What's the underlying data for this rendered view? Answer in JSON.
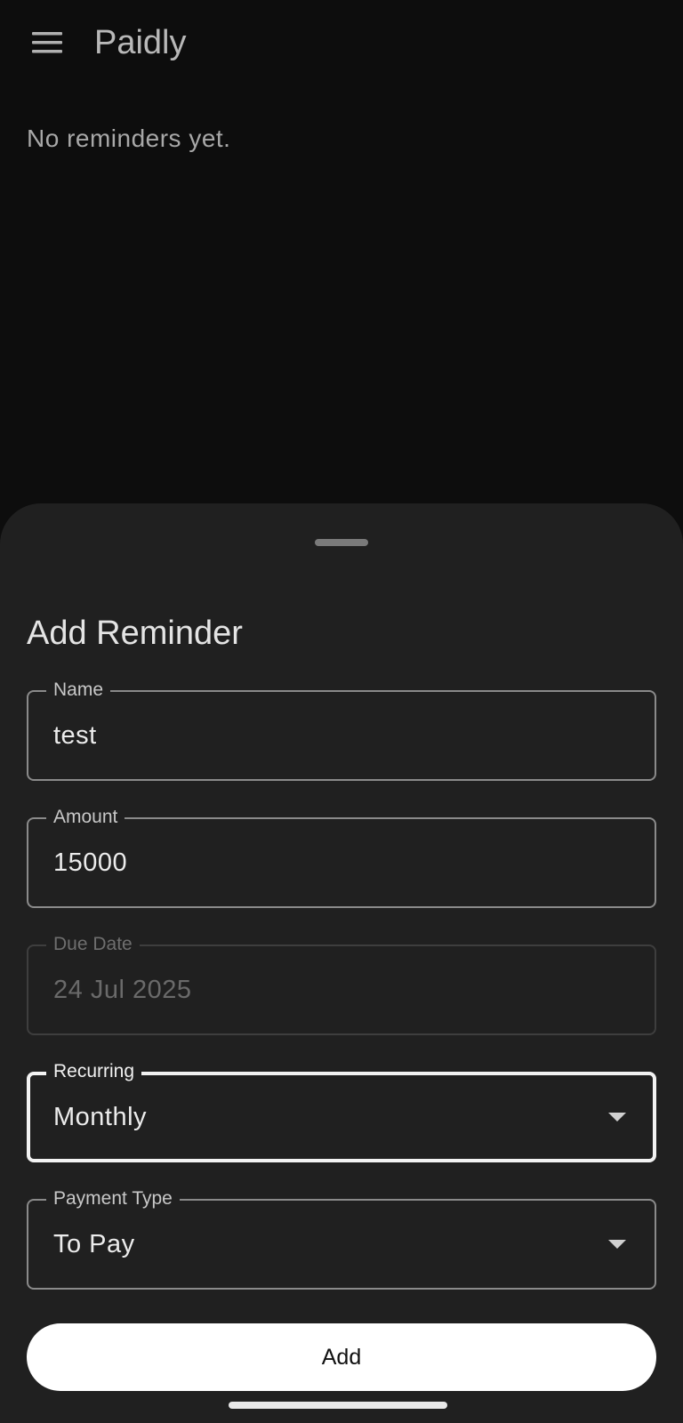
{
  "app_bar": {
    "title": "Paidly",
    "menu_icon": "hamburger-menu-icon"
  },
  "main": {
    "empty_message": "No reminders yet."
  },
  "sheet": {
    "title": "Add Reminder",
    "fields": {
      "name": {
        "label": "Name",
        "value": "test"
      },
      "amount": {
        "label": "Amount",
        "value": "15000"
      },
      "due_date": {
        "label": "Due Date",
        "value": "24 Jul 2025",
        "state": "disabled"
      },
      "recurring": {
        "label": "Recurring",
        "value": "Monthly",
        "state": "focused",
        "icon": "dropdown-arrow-icon"
      },
      "payment_type": {
        "label": "Payment Type",
        "value": "To Pay",
        "icon": "dropdown-arrow-icon"
      }
    },
    "add_button_label": "Add"
  },
  "colors": {
    "background": "#0d0d0d",
    "sheet": "#202020",
    "primary_button": "#ffffff",
    "text_primary": "#ececec",
    "text_muted": "#a8a8a8"
  }
}
